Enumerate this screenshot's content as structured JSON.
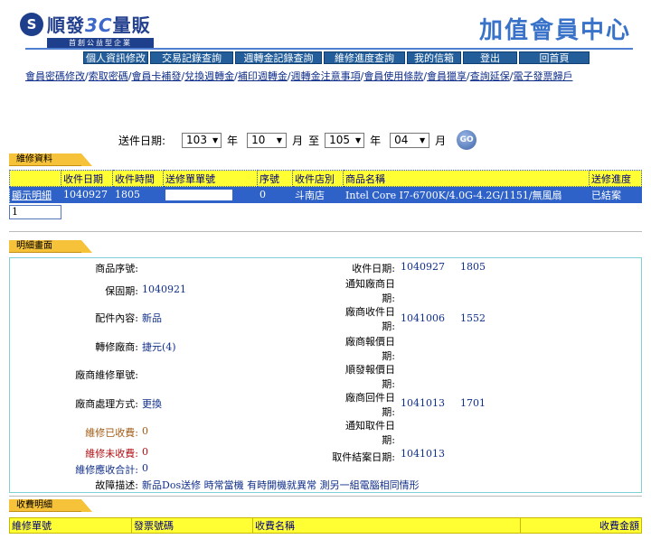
{
  "header": {
    "logo_text": "順發",
    "logo_number": "3C",
    "logo_suffix": "量販",
    "logo_tagline": "首創公益型企業",
    "center_title": "加值會員中心"
  },
  "nav_tabs": [
    "個人資訊修改",
    "交易記錄查詢",
    "週轉金記錄查詢",
    "維修進度查詢",
    "我的信箱",
    "登出",
    "回首頁"
  ],
  "links": [
    "會員密碼修改",
    "索取密碼",
    "會員卡補發",
    "兌換週轉金",
    "補印週轉金",
    "週轉金注意事項",
    "會員使用條款",
    "會員獵享",
    "查詢延保",
    "電子發票歸戶"
  ],
  "filter": {
    "label": "送件日期:",
    "from_year": "103",
    "from_month": "10",
    "to_year": "105",
    "to_month": "04",
    "year_unit": "年",
    "month_unit": "月",
    "to_label": "至",
    "go_label": "GO"
  },
  "repair_section": {
    "title": "維修資料",
    "columns": [
      "",
      "收件日期",
      "收件時間",
      "送修單單號",
      "序號",
      "收件店別",
      "商品名稱",
      "送修進度"
    ],
    "row": {
      "detail_link": "顯示明細",
      "date": "1040927",
      "time": "1805",
      "order_no": "",
      "serial": "0",
      "store": "斗南店",
      "product": "Intel Core I7-6700K/4.0G-4.2G/1151/無風扇",
      "status": "已結案"
    },
    "page": "1"
  },
  "detail_section": {
    "title": "明細畫面",
    "product_serial_label": "商品序號:",
    "product_serial": "",
    "warranty_label": "保固期:",
    "warranty": "1040921",
    "accessories_label": "配件內容:",
    "accessories": "新品",
    "transfer_vendor_label": "轉修廠商:",
    "transfer_vendor": "捷元(4)",
    "vendor_repair_no_label": "廠商維修單號:",
    "vendor_repair_no": "",
    "vendor_method_label": "廠商處理方式:",
    "vendor_method": "更換",
    "paid_label": "維修已收費:",
    "paid": "0",
    "unpaid_label": "維修未收費:",
    "unpaid": "0",
    "total_label": "維修應收合計:",
    "total": "0",
    "fault_label": "故障描述:",
    "fault": "新品Dos送修 時常當機 有時開機就異常 測另一組電腦相同情形",
    "receive_date_label": "收件日期:",
    "receive_date": "1040927",
    "receive_time": "1805",
    "notify_vendor_label": "通知廠商日期:",
    "notify_vendor": "",
    "vendor_receive_label": "廠商收件日期:",
    "vendor_receive_date": "1041006",
    "vendor_receive_time": "1552",
    "vendor_quote_label": "廠商報價日期:",
    "vendor_quote": "",
    "shunfa_quote_label": "順發報價日期:",
    "shunfa_quote": "",
    "vendor_return_label": "廠商回件日期:",
    "vendor_return_date": "1041013",
    "vendor_return_time": "1701",
    "notify_pickup_label": "通知取件日期:",
    "notify_pickup": "",
    "pickup_done_label": "取件結案日期:",
    "pickup_done": "1041013"
  },
  "fee_section": {
    "title": "收費明細",
    "columns": [
      "維修單號",
      "發票號碼",
      "收費名稱",
      "收費金額"
    ]
  }
}
